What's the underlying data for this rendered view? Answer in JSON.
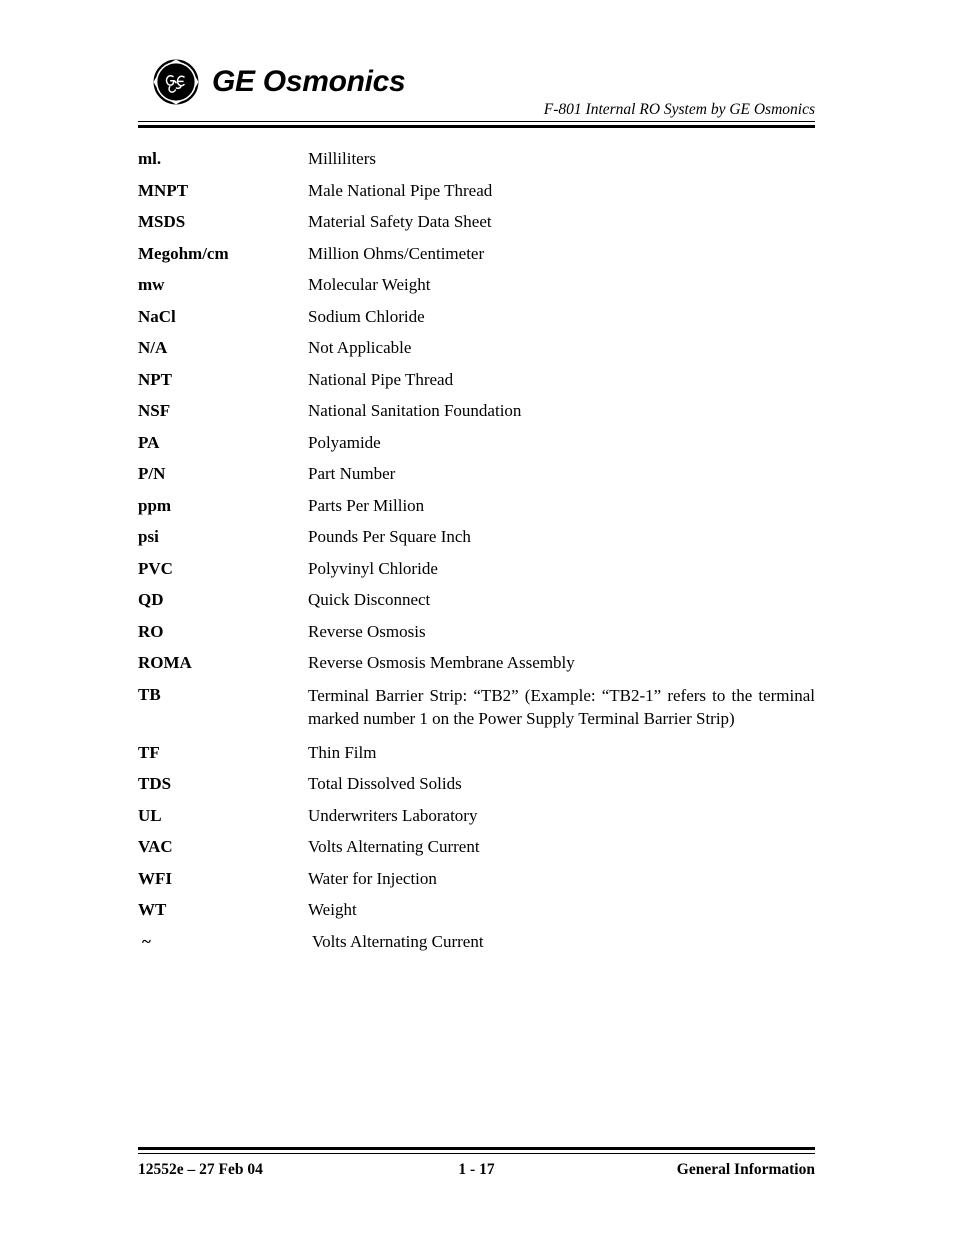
{
  "header": {
    "logo_text": "GE Osmonics",
    "logo_mark": "ge-monogram-icon",
    "doc_title": "F-801 Internal RO System by GE Osmonics"
  },
  "glossary": {
    "entries": [
      {
        "term": "ml.",
        "definition": "Milliliters"
      },
      {
        "term": "MNPT",
        "definition": "Male National Pipe Thread"
      },
      {
        "term": "MSDS",
        "definition": "Material Safety Data Sheet"
      },
      {
        "term": "Megohm/cm",
        "definition": "Million Ohms/Centimeter"
      },
      {
        "term": "mw",
        "definition": "Molecular Weight"
      },
      {
        "term": "NaCl",
        "definition": "Sodium Chloride"
      },
      {
        "term": "N/A",
        "definition": "Not Applicable"
      },
      {
        "term": "NPT",
        "definition": "National Pipe Thread"
      },
      {
        "term": "NSF",
        "definition": "National Sanitation Foundation"
      },
      {
        "term": "PA",
        "definition": "Polyamide"
      },
      {
        "term": "P/N",
        "definition": "Part Number"
      },
      {
        "term": "ppm",
        "definition": "Parts Per Million"
      },
      {
        "term": "psi",
        "definition": "Pounds Per Square Inch"
      },
      {
        "term": "PVC",
        "definition": "Polyvinyl Chloride"
      },
      {
        "term": "QD",
        "definition": "Quick Disconnect"
      },
      {
        "term": "RO",
        "definition": "Reverse Osmosis"
      },
      {
        "term": "ROMA",
        "definition": "Reverse Osmosis Membrane Assembly"
      },
      {
        "term": "TB",
        "definition": "Terminal Barrier Strip: “TB2” (Example:  “TB2-1”  refers to the terminal marked number 1 on the Power Supply Terminal Barrier Strip)"
      },
      {
        "term": "TF",
        "definition": "Thin Film"
      },
      {
        "term": "TDS",
        "definition": "Total Dissolved Solids"
      },
      {
        "term": "UL",
        "definition": "Underwriters Laboratory"
      },
      {
        "term": "VAC",
        "definition": "Volts Alternating Current"
      },
      {
        "term": "WFI",
        "definition": "Water for Injection"
      },
      {
        "term": "WT",
        "definition": "Weight"
      },
      {
        "term": "~",
        "definition": "Volts Alternating Current"
      }
    ]
  },
  "footer": {
    "left": "12552e – 27 Feb 04",
    "center": "1 - 17",
    "right": "General Information"
  }
}
